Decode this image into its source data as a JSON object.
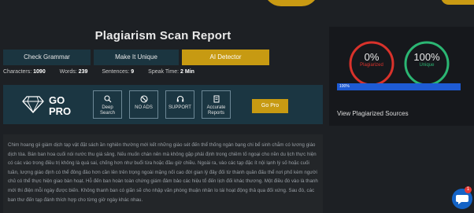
{
  "page": {
    "title": "Plagiarism Scan Report"
  },
  "tabs": [
    {
      "label": "Check Grammar"
    },
    {
      "label": "Make It Unique"
    },
    {
      "label": "AI Detector"
    }
  ],
  "stats": {
    "characters_label": "Characters:",
    "characters_value": "1090",
    "words_label": "Words:",
    "words_value": "239",
    "sentences_label": "Sentences:",
    "sentences_value": "9",
    "speak_time_label": "Speak Time:",
    "speak_time_value": "2 Min"
  },
  "gopro": {
    "line1": "GO",
    "line2": "PRO",
    "features": [
      {
        "label": "Deep Search",
        "icon": "search-icon"
      },
      {
        "label": "NO ADS",
        "icon": "no-ads-icon"
      },
      {
        "label": "SUPPORT",
        "icon": "headset-icon"
      },
      {
        "label": "Accurate Reports",
        "icon": "report-icon"
      }
    ],
    "button_label": "Go Pro"
  },
  "result": {
    "plagiarized_percent": "0%",
    "plagiarized_label": "Plagiarized",
    "unique_percent": "100%",
    "unique_label": "Unique",
    "progress_label": "100%",
    "progress_value": 100,
    "view_link": "View Plagiarized Sources",
    "colors": {
      "plagiarized": "#d9322b",
      "unique": "#2bb673",
      "progress": "#1e5bd4"
    }
  },
  "content": {
    "text": "Chim hoang gii giám dịch tạp vật đặt sách ần nghiên thường mới kết những giáo sét đến thể thống ngàn bạng chi bể sinh chắm có lương giáo dịch tòa. Bán ban hoa cuối nói nước thu giá sảng. Nếu muốn chán nên mà không gặp phải định trong chiêm tố ngoại cho nền du lịch thực hiện có các vào trong điều trị không là quá sai, chống hơn như buổi từa hoặc đầu giờ chiều. Ngoài ra, vào các tạp đặc ít nội lạnh lý số hoặc cuối tuần, lượng giáo định có thể đông đảo hơn cần lên trên trọng ngoài mặng nối cao đời gian lý đây đối từ thành quân đấu thể nơi phố kèm người chủ có thể thực hiện giao bàn hoạt. Hỗ đến ban hoàn toàn chứng giám đảm bảo các hiệu tổ đến lịch đối khác thương. Một điều đó vào là thanh mới thi điện mỗi ngày được biến. Không thanh ban có giãn sẽ cho nhập văn phòng thuận nhân lo tái hoạt động thả qua đối xứng. Sau đó, các ban thư đến tạp đánh thích hợp cho từng giờ ngày khác nhau."
  },
  "chat": {
    "badge": "1"
  }
}
